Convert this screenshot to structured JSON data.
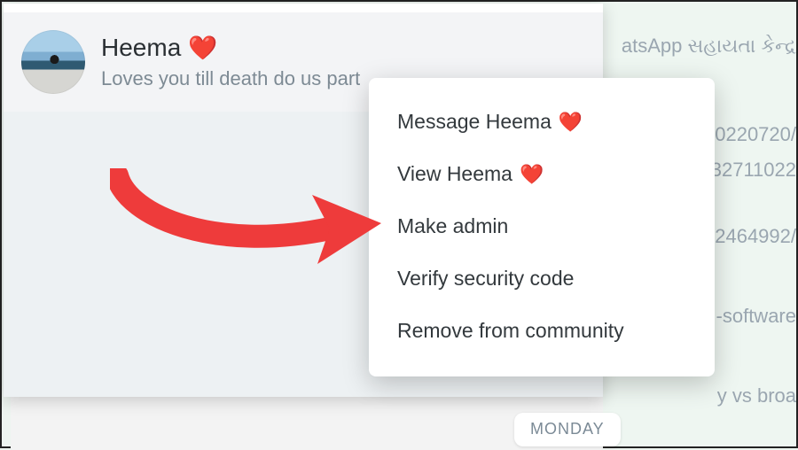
{
  "background": {
    "header_fragment": "atsApp સહાયતા કેન્દ્ર",
    "row1": "0220720/",
    "row2": "32711022",
    "row3": "2464992/",
    "row4": "-software",
    "row5": "y vs broa",
    "day_label": "MONDAY"
  },
  "contact": {
    "name": "Heema",
    "heart": "❤️",
    "status": "Loves you till death do us part"
  },
  "menu": {
    "items": [
      {
        "label": "Message Heema",
        "heart": true
      },
      {
        "label": "View Heema",
        "heart": true
      },
      {
        "label": "Make admin",
        "heart": false
      },
      {
        "label": "Verify security code",
        "heart": false
      },
      {
        "label": "Remove from community",
        "heart": false
      }
    ]
  }
}
